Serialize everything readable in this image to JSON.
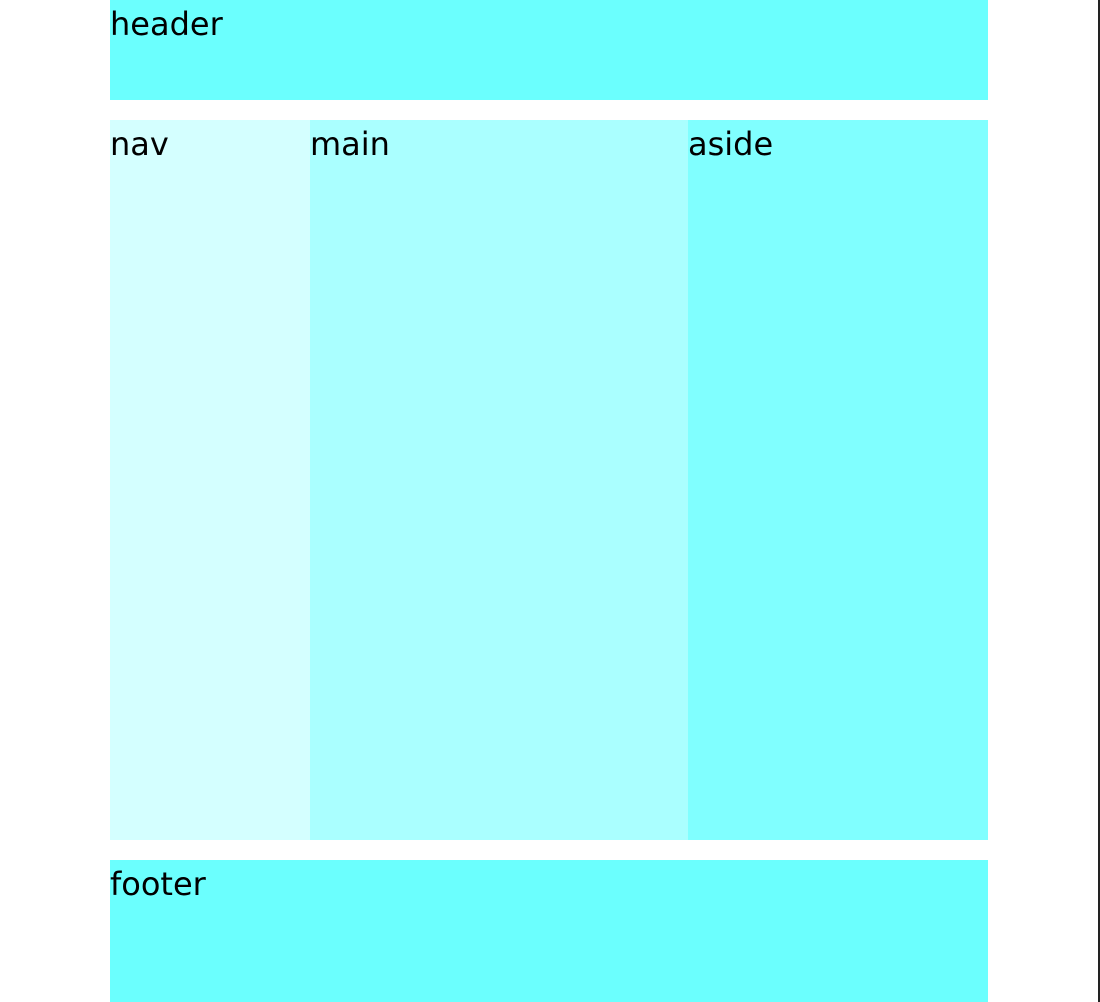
{
  "header": {
    "label": "header"
  },
  "nav": {
    "label": "nav"
  },
  "main": {
    "label": "main"
  },
  "aside": {
    "label": "aside"
  },
  "footer": {
    "label": "footer"
  },
  "colors": {
    "header": "#6bfffe",
    "nav": "#d4ffff",
    "main": "#aaffff",
    "aside": "#80ffff",
    "footer": "#6bfffe",
    "background": "#ffffff"
  }
}
